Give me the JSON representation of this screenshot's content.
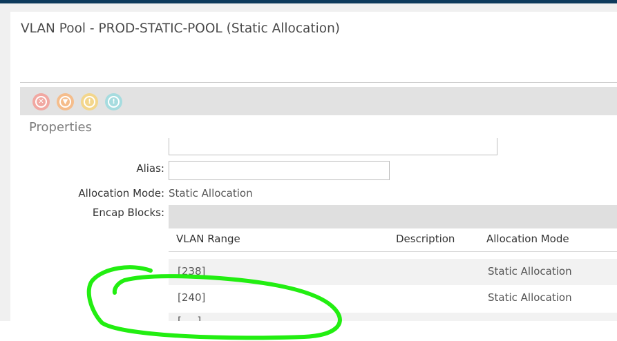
{
  "window": {
    "title": "VLAN Pool - PROD-STATIC-POOL (Static Allocation)"
  },
  "fault_icons": [
    {
      "name": "critical-fault-icon",
      "color": "#f1a8a2"
    },
    {
      "name": "major-fault-icon",
      "color": "#f5bd8c"
    },
    {
      "name": "minor-fault-icon",
      "color": "#f3d68c"
    },
    {
      "name": "warning-fault-icon",
      "color": "#a6dcdf"
    }
  ],
  "properties": {
    "heading": "Properties",
    "alias_label": "Alias:",
    "alias_value": "",
    "allocation_mode_label": "Allocation Mode:",
    "allocation_mode_value": "Static Allocation",
    "encap_blocks_label": "Encap Blocks:"
  },
  "encap_table": {
    "columns": [
      "VLAN Range",
      "Description",
      "Allocation Mode"
    ],
    "rows": [
      {
        "range": "[238]",
        "description": "",
        "mode": "Static Allocation"
      },
      {
        "range": "[240]",
        "description": "",
        "mode": "Static Allocation"
      },
      {
        "range": "[___]",
        "description": "",
        "mode": ""
      }
    ]
  },
  "annotation": {
    "color": "#22ee11",
    "shape": "hand-drawn-circle"
  }
}
